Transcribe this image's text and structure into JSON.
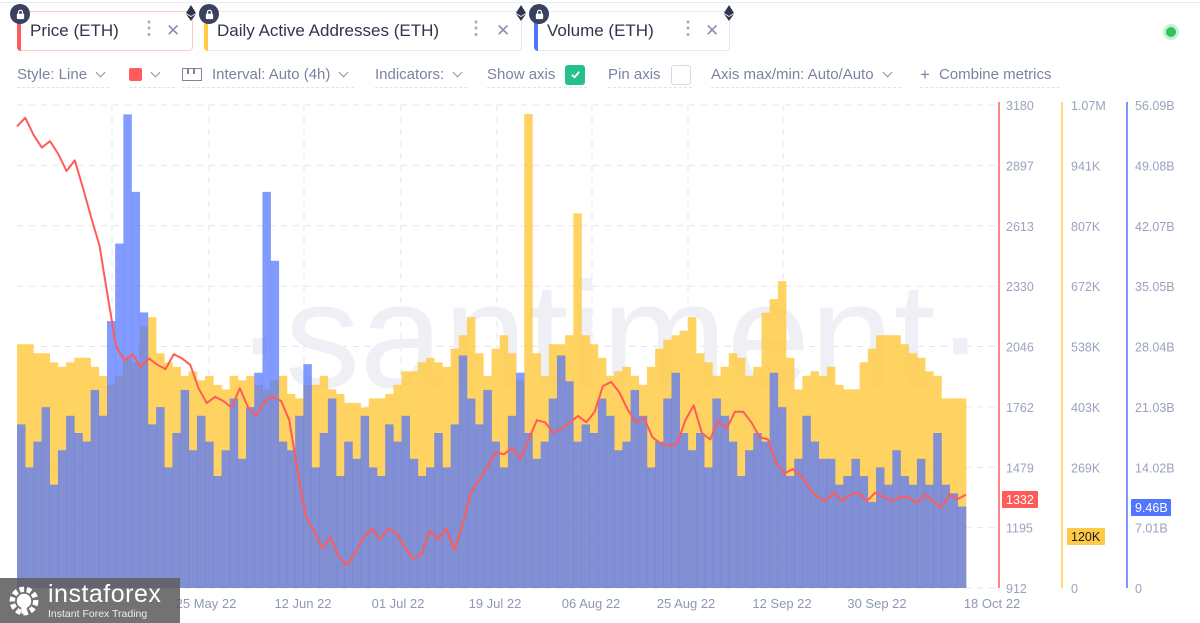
{
  "metrics": [
    {
      "label": "Price (ETH)",
      "color": "#ff5b5b",
      "bg": "#fff0f0",
      "menu_icon": "more-vertical-icon",
      "close_icon": "close-icon",
      "lock_icon": "lock-icon",
      "asset_icon": "ethereum-icon"
    },
    {
      "label": "Daily Active Addresses (ETH)",
      "color": "#ffcb47",
      "bg": "#ffffff",
      "menu_icon": "more-vertical-icon",
      "close_icon": "close-icon",
      "lock_icon": "lock-icon",
      "asset_icon": "ethereum-icon"
    },
    {
      "label": "Volume (ETH)",
      "color": "#5275ff",
      "bg": "#ffffff",
      "menu_icon": "more-vertical-icon",
      "close_icon": "close-icon",
      "lock_icon": "lock-icon",
      "asset_icon": "ethereum-icon"
    }
  ],
  "settings": {
    "style": "Style: Line",
    "color_swatch": "#ff5b5b",
    "interval": "Interval: Auto (4h)",
    "indicators": "Indicators:",
    "show_axis": "Show axis",
    "show_axis_checked": true,
    "pin_axis": "Pin axis",
    "pin_axis_checked": false,
    "axis_maxmin": "Axis max/min: Auto/Auto",
    "combine": "Combine metrics",
    "combine_icon": "plus-icon"
  },
  "status": {
    "online": true,
    "color": "#2fc35a"
  },
  "watermark": "·santiment·",
  "branding": {
    "name": "instaforex",
    "tagline": "Instant Forex Trading"
  },
  "chart_data": {
    "type": "bar",
    "title": "",
    "x_ticks": [
      "25 May 22",
      "12 Jun 22",
      "01 Jul 22",
      "19 Jul 22",
      "06 Aug 22",
      "25 Aug 22",
      "12 Sep 22",
      "30 Sep 22",
      "18 Oct 22"
    ],
    "x_range": [
      "~07 May 22",
      "18 Oct 22"
    ],
    "grid": true,
    "axes": [
      {
        "metric": "Price (ETH)",
        "color": "#ff5b5b",
        "ticks": [
          "3180",
          "2897",
          "2613",
          "2330",
          "2046",
          "1762",
          "1479",
          "1195",
          "912"
        ],
        "ylim": [
          912,
          3180
        ],
        "current_value": "1332"
      },
      {
        "metric": "Daily Active Addresses (ETH)",
        "color": "#ffcb47",
        "ticks": [
          "1.07M",
          "941K",
          "807K",
          "672K",
          "538K",
          "403K",
          "269K",
          "134K",
          "0"
        ],
        "ylim": [
          0,
          1070000
        ],
        "current_value": "120K"
      },
      {
        "metric": "Volume (ETH)",
        "color": "#5275ff",
        "ticks": [
          "56.09B",
          "49.08B",
          "42.07B",
          "35.05B",
          "28.04B",
          "21.03B",
          "14.02B",
          "7.01B",
          "0"
        ],
        "ylim": [
          0,
          56090000000
        ],
        "current_value": "9.46B"
      }
    ],
    "series": [
      {
        "name": "Price (ETH)",
        "type": "line",
        "color": "#ff5b5b",
        "unit": "USD",
        "values": [
          3080,
          3120,
          3040,
          2980,
          3010,
          2950,
          2870,
          2920,
          2790,
          2650,
          2520,
          2280,
          2050,
          1980,
          2010,
          1950,
          1990,
          1960,
          1940,
          2010,
          1990,
          1960,
          1850,
          1780,
          1810,
          1790,
          1760,
          1850,
          1760,
          1720,
          1790,
          1810,
          1790,
          1700,
          1460,
          1250,
          1180,
          1100,
          1150,
          1060,
          1020,
          1080,
          1150,
          1190,
          1140,
          1190,
          1170,
          1100,
          1050,
          1070,
          1180,
          1140,
          1190,
          1090,
          1210,
          1360,
          1420,
          1480,
          1550,
          1540,
          1570,
          1520,
          1610,
          1700,
          1690,
          1640,
          1660,
          1690,
          1720,
          1690,
          1740,
          1860,
          1880,
          1830,
          1750,
          1690,
          1710,
          1620,
          1590,
          1580,
          1590,
          1700,
          1770,
          1640,
          1610,
          1700,
          1660,
          1740,
          1740,
          1690,
          1620,
          1610,
          1500,
          1450,
          1470,
          1440,
          1380,
          1340,
          1320,
          1360,
          1320,
          1350,
          1360,
          1320,
          1360,
          1340,
          1320,
          1340,
          1340,
          1310,
          1350,
          1320,
          1290,
          1350,
          1330,
          1350
        ]
      },
      {
        "name": "Daily Active Addresses (ETH)",
        "type": "bar",
        "color": "#ffcb47",
        "unit": "addresses",
        "values": [
          540000,
          540000,
          520000,
          520000,
          500000,
          490000,
          500000,
          510000,
          510000,
          490000,
          470000,
          450000,
          470000,
          510000,
          500000,
          580000,
          600000,
          520000,
          500000,
          490000,
          470000,
          480000,
          460000,
          470000,
          450000,
          440000,
          470000,
          460000,
          470000,
          450000,
          440000,
          460000,
          470000,
          430000,
          420000,
          450000,
          450000,
          470000,
          440000,
          430000,
          410000,
          410000,
          400000,
          420000,
          420000,
          430000,
          450000,
          480000,
          480000,
          500000,
          510000,
          500000,
          490000,
          530000,
          560000,
          600000,
          520000,
          470000,
          530000,
          560000,
          520000,
          460000,
          1050000,
          520000,
          470000,
          540000,
          540000,
          560000,
          830000,
          560000,
          540000,
          510000,
          470000,
          480000,
          490000,
          470000,
          450000,
          490000,
          530000,
          550000,
          560000,
          570000,
          600000,
          520000,
          500000,
          470000,
          490000,
          520000,
          510000,
          470000,
          490000,
          610000,
          640000,
          680000,
          510000,
          440000,
          470000,
          480000,
          470000,
          490000,
          450000,
          440000,
          440000,
          500000,
          530000,
          560000,
          560000,
          560000,
          540000,
          520000,
          510000,
          480000,
          470000,
          420000,
          420000,
          420000
        ]
      },
      {
        "name": "Volume (ETH)",
        "type": "bar",
        "color": "#5275ff",
        "unit": "USD",
        "values": [
          19000000000,
          14000000000,
          17000000000,
          21000000000,
          12000000000,
          16000000000,
          20000000000,
          18000000000,
          17000000000,
          23000000000,
          20000000000,
          31000000000,
          40000000000,
          55000000000,
          46000000000,
          32000000000,
          19000000000,
          21000000000,
          14000000000,
          18000000000,
          23000000000,
          16000000000,
          20000000000,
          17000000000,
          13000000000,
          16000000000,
          22000000000,
          15000000000,
          21000000000,
          25000000000,
          46000000000,
          38000000000,
          17000000000,
          16000000000,
          20000000000,
          26000000000,
          14000000000,
          18000000000,
          22000000000,
          13000000000,
          17000000000,
          15000000000,
          20000000000,
          14000000000,
          13000000000,
          19000000000,
          17000000000,
          20000000000,
          15000000000,
          13000000000,
          14000000000,
          18000000000,
          14000000000,
          19000000000,
          27000000000,
          22000000000,
          19000000000,
          23000000000,
          17000000000,
          14000000000,
          20000000000,
          25000000000,
          18000000000,
          15000000000,
          17000000000,
          22000000000,
          27000000000,
          24000000000,
          17000000000,
          19000000000,
          18000000000,
          22000000000,
          20000000000,
          16000000000,
          17000000000,
          23000000000,
          20000000000,
          14000000000,
          17000000000,
          22000000000,
          25000000000,
          18000000000,
          16000000000,
          18000000000,
          14000000000,
          22000000000,
          20000000000,
          17000000000,
          13000000000,
          16000000000,
          18000000000,
          17000000000,
          25000000000,
          21000000000,
          13000000000,
          15000000000,
          20000000000,
          17000000000,
          15000000000,
          15000000000,
          12000000000,
          13000000000,
          15000000000,
          13000000000,
          10000000000,
          14000000000,
          12000000000,
          16000000000,
          13000000000,
          12000000000,
          15000000000,
          12000000000,
          18000000000,
          12000000000,
          11000000000,
          9460000000
        ]
      }
    ]
  }
}
